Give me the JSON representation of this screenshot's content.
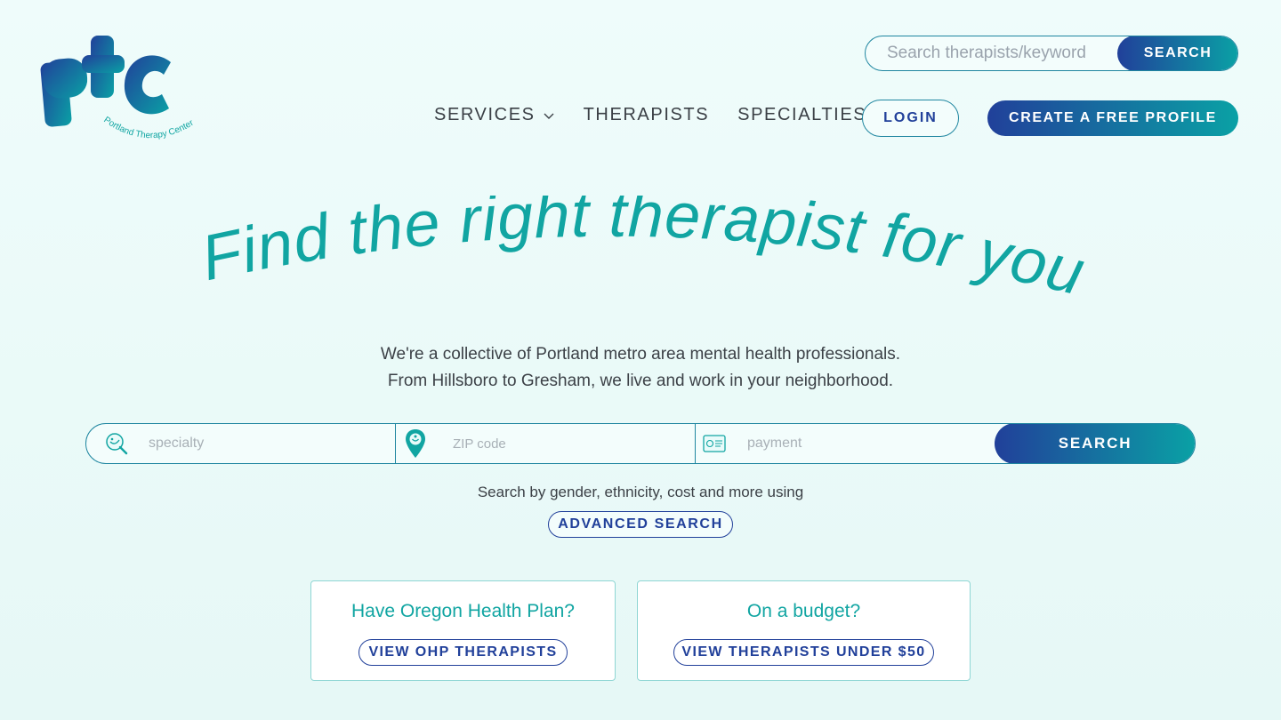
{
  "brand": {
    "logo_letters": "PTC",
    "logo_subtitle": "Portland Therapy Center"
  },
  "header": {
    "search_placeholder": "Search therapists/keyword",
    "search_button": "SEARCH",
    "nav": [
      {
        "label": "SERVICES",
        "has_dropdown": true
      },
      {
        "label": "THERAPISTS"
      },
      {
        "label": "SPECIALTIES"
      }
    ],
    "login": "LOGIN",
    "create_profile": "CREATE A FREE PROFILE"
  },
  "hero": {
    "headline": "Find the right therapist for you",
    "intro_line1": "We're a collective of Portland metro area mental health professionals.",
    "intro_line2": "From Hillsboro to Gresham, we live and work in your neighborhood."
  },
  "search": {
    "specialty_placeholder": "specialty",
    "zip_placeholder": "ZIP code",
    "payment_placeholder": "payment",
    "button": "SEARCH",
    "advanced_text": "Search by gender, ethnicity, cost and more using",
    "advanced_button": "ADVANCED SEARCH"
  },
  "cards": [
    {
      "title": "Have Oregon Health Plan?",
      "button": "VIEW OHP THERAPISTS"
    },
    {
      "title": "On a budget?",
      "button": "VIEW THERAPISTS UNDER $50"
    }
  ],
  "colors": {
    "navy": "#21409a",
    "teal": "#0aa1a5",
    "headline": "#11a5a2",
    "background": "#effcfb"
  },
  "icons": [
    "chevron-down-icon",
    "specialty-search-icon",
    "location-pin-icon",
    "payment-card-icon"
  ]
}
